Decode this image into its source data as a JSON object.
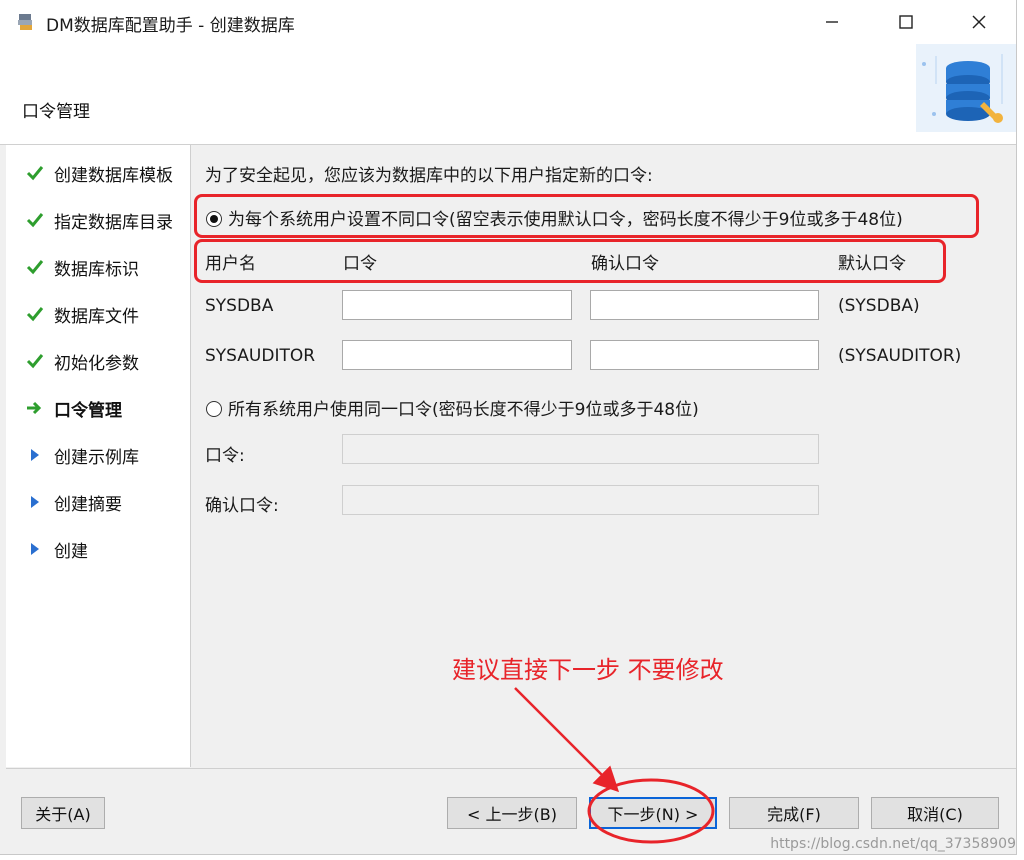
{
  "window": {
    "title": "DM数据库配置助手 - 创建数据库",
    "minimize_glyph": "—",
    "maximize_glyph": "☐",
    "close_glyph": "✕"
  },
  "header": {
    "title": "口令管理",
    "banner_icon": "database-config-icon"
  },
  "steps": [
    {
      "label": "创建数据库模板",
      "state": "done",
      "icon": "check-icon"
    },
    {
      "label": "指定数据库目录",
      "state": "done",
      "icon": "check-icon"
    },
    {
      "label": "数据库标识",
      "state": "done",
      "icon": "check-icon"
    },
    {
      "label": "数据库文件",
      "state": "done",
      "icon": "check-icon"
    },
    {
      "label": "初始化参数",
      "state": "done",
      "icon": "check-icon"
    },
    {
      "label": "口令管理",
      "state": "current",
      "icon": "arrow-right-icon"
    },
    {
      "label": "创建示例库",
      "state": "pending",
      "icon": "triangle-right-icon"
    },
    {
      "label": "创建摘要",
      "state": "pending",
      "icon": "triangle-right-icon"
    },
    {
      "label": "创建",
      "state": "pending",
      "icon": "triangle-right-icon"
    }
  ],
  "main": {
    "intro": "为了安全起见，您应该为数据库中的以下用户指定新的口令:",
    "option_individual": {
      "label": "为每个系统用户设置不同口令(留空表示使用默认口令，密码长度不得少于9位或多于48位)",
      "selected": true
    },
    "columns": {
      "username": "用户名",
      "password": "口令",
      "confirm": "确认口令",
      "default": "默认口令"
    },
    "users": [
      {
        "name": "SYSDBA",
        "password": "",
        "confirm": "",
        "default": "(SYSDBA)"
      },
      {
        "name": "SYSAUDITOR",
        "password": "",
        "confirm": "",
        "default": "(SYSAUDITOR)"
      }
    ],
    "option_shared": {
      "label": "所有系统用户使用同一口令(密码长度不得少于9位或多于48位)",
      "selected": false
    },
    "shared_password_label": "口令:",
    "shared_password_value": "",
    "shared_confirm_label": "确认口令:",
    "shared_confirm_value": ""
  },
  "footer": {
    "about": "关于(A)",
    "back": "< 上一步(B)",
    "next": "下一步(N) >",
    "finish": "完成(F)",
    "cancel": "取消(C)"
  },
  "annotation": {
    "text": "建议直接下一步 不要修改",
    "color": "#e8242a"
  },
  "watermark": "https://blog.csdn.net/qq_37358909",
  "colors": {
    "accent_red": "#e8242a",
    "check_green": "#2e9e2e",
    "pending_blue": "#2a6fd0",
    "default_button_border": "#0a64d8"
  }
}
